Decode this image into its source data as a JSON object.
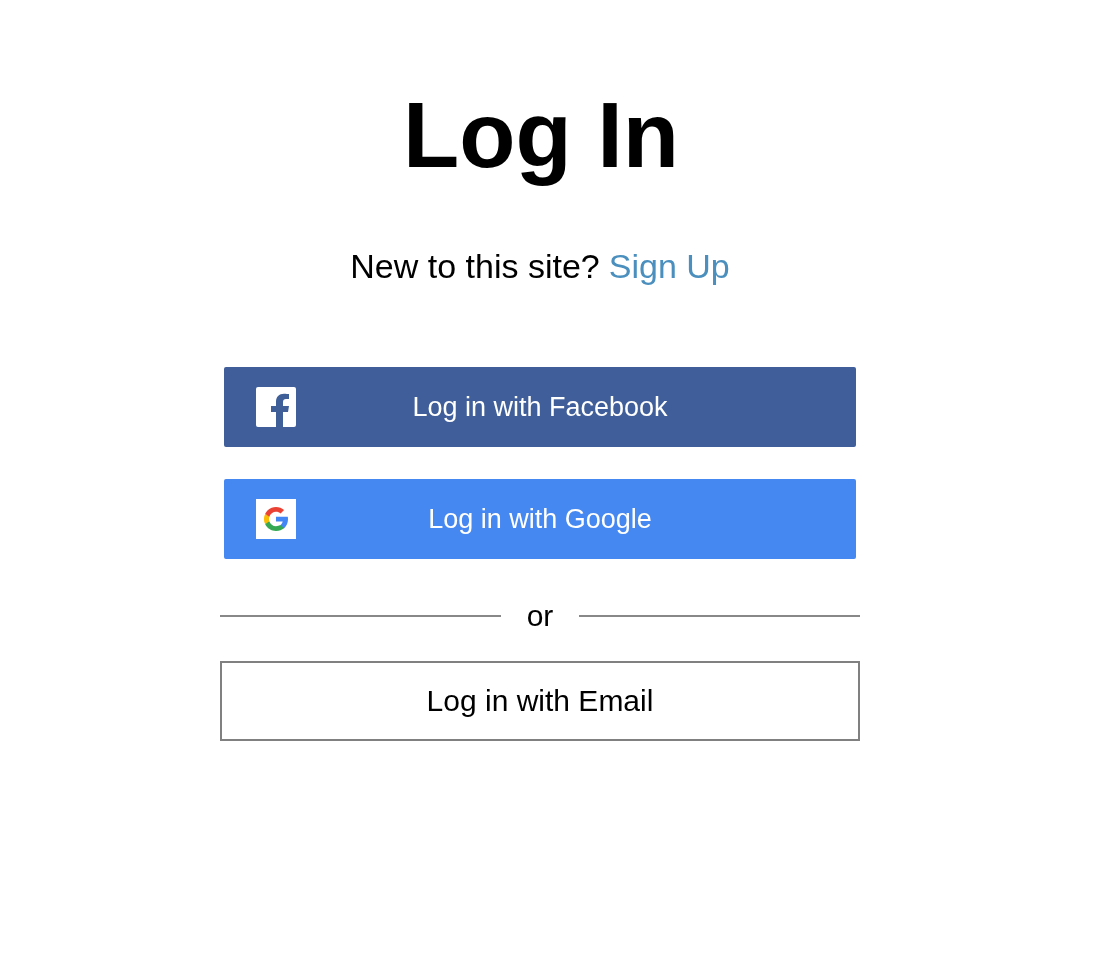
{
  "title": "Log In",
  "signup": {
    "prompt": "New to this site?",
    "link": "Sign Up"
  },
  "social_buttons": [
    {
      "kind": "facebook",
      "label": "Log in with Facebook"
    },
    {
      "kind": "google",
      "label": "Log in with Google"
    }
  ],
  "divider": "or",
  "email_button": {
    "label": "Log in with Email"
  }
}
